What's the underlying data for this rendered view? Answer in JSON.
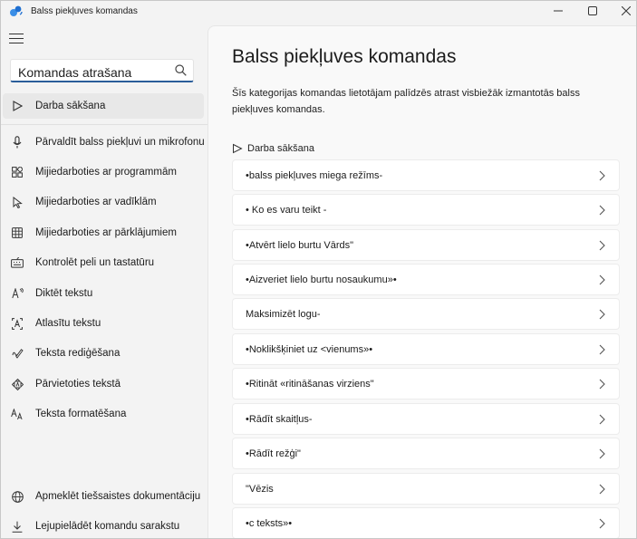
{
  "window": {
    "title": "Balss piekļuves komandas",
    "minimize": "—",
    "maximize": "☐",
    "close": "✕"
  },
  "search": {
    "placeholder": "Komandas atrašana"
  },
  "nav": {
    "items": [
      {
        "label": "Darba sākšana",
        "icon": "play-triangle-icon",
        "active": true
      },
      {
        "label": "Pārvaldīt balss piekļuvi un mikrofonu",
        "icon": "microphone-icon"
      },
      {
        "label": "Mijiedarboties ar programmām",
        "icon": "apps-icon"
      },
      {
        "label": "Mijiedarboties ar vadīklām",
        "icon": "cursor-icon"
      },
      {
        "label": "Mijiedarboties ar pārklājumiem",
        "icon": "grid-icon"
      },
      {
        "label": "Kontrolēt peli un tastatūru",
        "icon": "keyboard-icon"
      },
      {
        "label": "Diktēt tekstu",
        "icon": "dictate-icon"
      },
      {
        "label": "Atlasītu tekstu",
        "icon": "select-text-icon"
      },
      {
        "label": "Teksta rediģēšana",
        "icon": "edit-text-icon"
      },
      {
        "label": "Pārvietoties tekstā",
        "icon": "navigate-icon"
      },
      {
        "label": "Teksta formatēšana",
        "icon": "format-text-icon"
      }
    ],
    "footer": [
      {
        "label": "Apmeklēt tiešsaistes dokumentāciju",
        "icon": "globe-icon"
      },
      {
        "label": "Lejupielādēt komandu sarakstu",
        "icon": "download-icon"
      }
    ]
  },
  "main": {
    "title": "Balss piekļuves komandas",
    "description": "Šīs kategorijas komandas lietotājam palīdzēs atrast visbiežāk izmantotās balss piekļuves komandas.",
    "section_label": "Darba sākšana",
    "commands": [
      "•balss piekļuves miega režīms-",
      "• Ko es varu teikt -",
      "•Atvērt lielo burtu Vārds\"",
      "•Aizveriet lielo burtu nosaukumu»•",
      "Maksimizēt logu-",
      "•Noklikšķiniet uz <vienums»•",
      "•Ritināt «ritināšanas virziens\"",
      "•Rādīt skaitļus-",
      "•Rādīt režģi\"",
      "\"Vēzis",
      "•c teksts»•"
    ]
  },
  "colors": {
    "accent": "#2a5d9a",
    "sidebar": "#f3f3f3",
    "content": "#f9f9f9"
  }
}
